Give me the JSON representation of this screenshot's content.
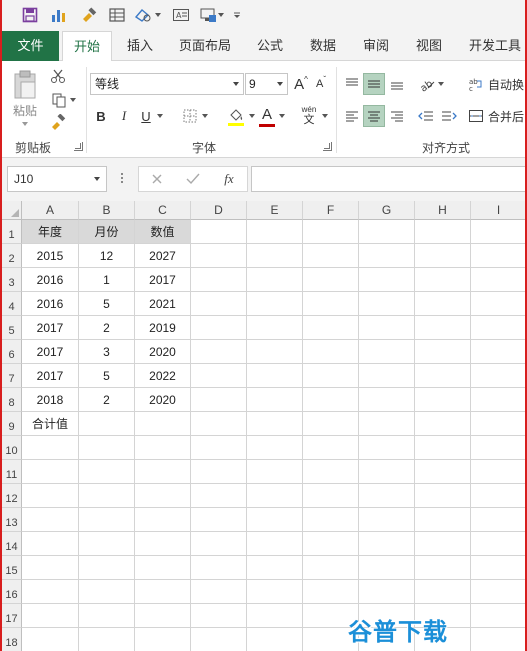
{
  "tabs": {
    "file": "文件",
    "home": "开始",
    "insert": "插入",
    "page_layout": "页面布局",
    "formulas": "公式",
    "data": "数据",
    "review": "审阅",
    "view": "视图",
    "developer": "开发工具"
  },
  "ribbon": {
    "clipboard": {
      "paste_label": "粘贴",
      "group_label": "剪贴板"
    },
    "font": {
      "font_name": "等线",
      "font_size": "9",
      "bold": "B",
      "italic": "I",
      "underline": "U",
      "phonetic": "wén",
      "phonetic_sub": "文",
      "font_color": "A",
      "group_label": "字体"
    },
    "alignment": {
      "wrap_text": "自动换",
      "merge_center": "合并后",
      "group_label": "对齐方式"
    },
    "colors": {
      "accent": "#217346",
      "highlight": "#b5d3c0",
      "font_color_bar": "#c00000",
      "fill_color_bar": "#ffff00"
    }
  },
  "formula_bar": {
    "name_box": "J10",
    "fx": "fx",
    "formula": ""
  },
  "sheet": {
    "columns": [
      "A",
      "B",
      "C",
      "D",
      "E",
      "F",
      "G",
      "H",
      "I"
    ],
    "rows": [
      "1",
      "2",
      "3",
      "4",
      "5",
      "6",
      "7",
      "8",
      "9",
      "10",
      "11",
      "12",
      "13",
      "14",
      "15",
      "16",
      "17",
      "18"
    ],
    "header_row": [
      "年度",
      "月份",
      "数值"
    ],
    "data_rows": [
      [
        "2015",
        "12",
        "2027"
      ],
      [
        "2016",
        "1",
        "2017"
      ],
      [
        "2016",
        "5",
        "2021"
      ],
      [
        "2017",
        "2",
        "2019"
      ],
      [
        "2017",
        "3",
        "2020"
      ],
      [
        "2017",
        "5",
        "2022"
      ],
      [
        "2018",
        "2",
        "2020"
      ]
    ],
    "total_label": "合计值"
  },
  "watermark": "谷普下载"
}
